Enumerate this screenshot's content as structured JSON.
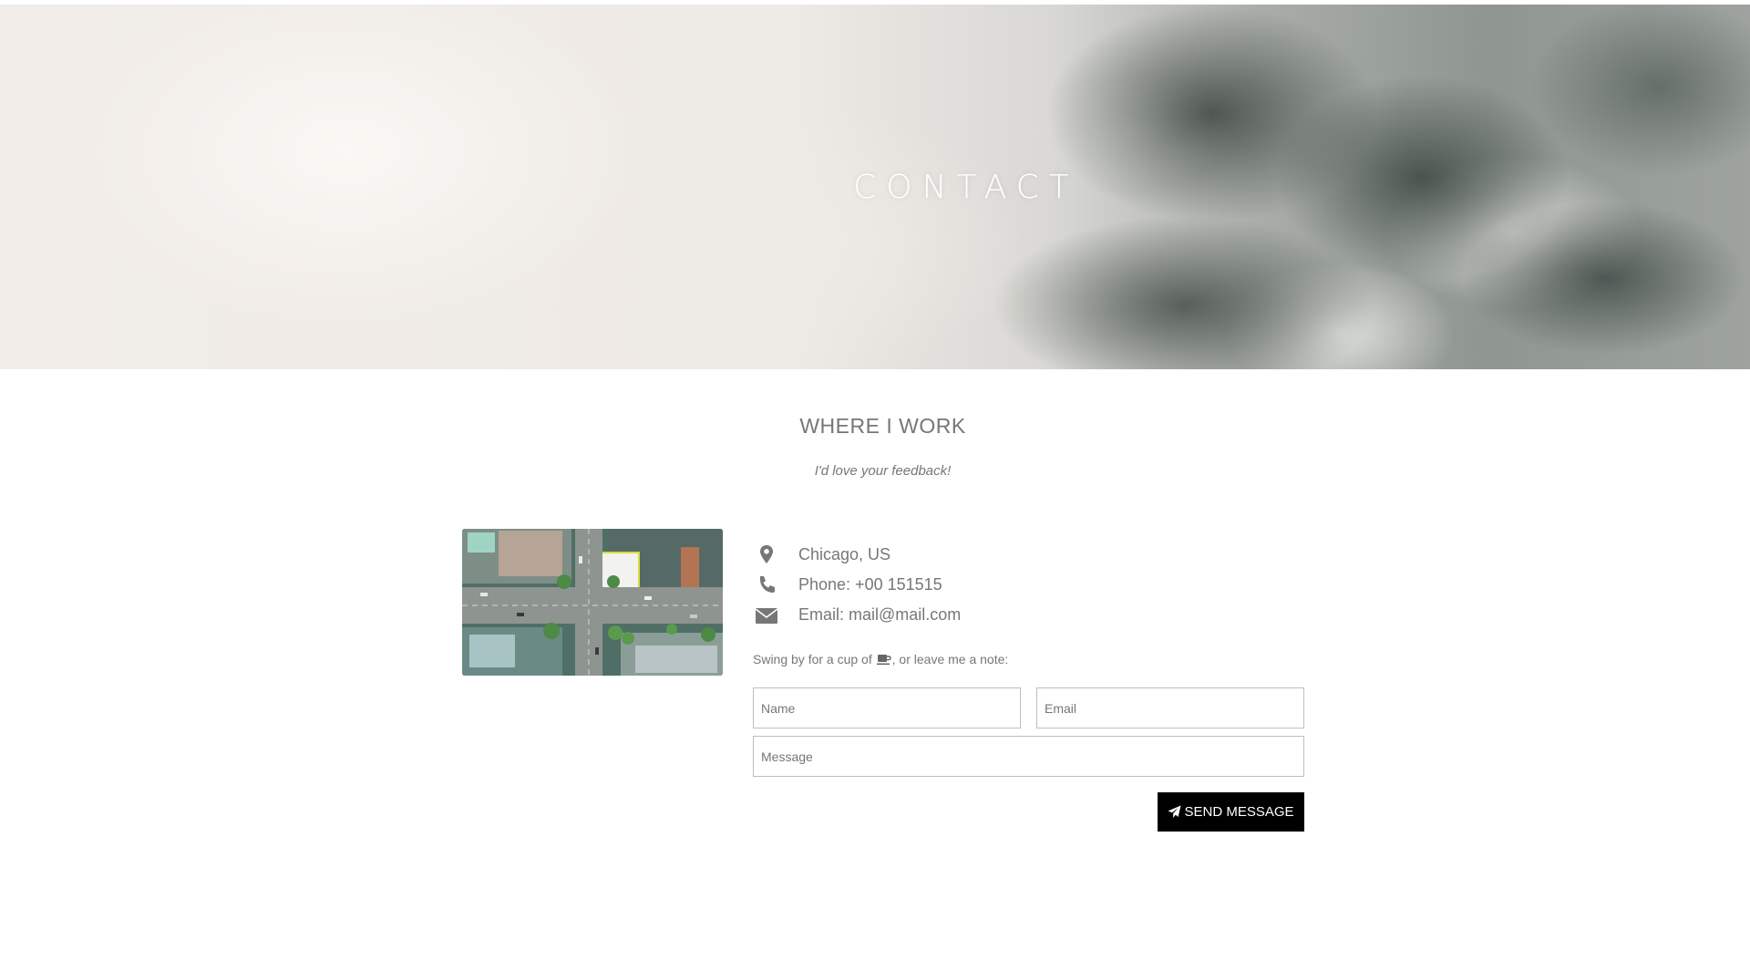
{
  "hero": {
    "title": "CONTACT"
  },
  "section": {
    "title": "WHERE I WORK",
    "subtitle": "I'd love your feedback!"
  },
  "contact_info": [
    {
      "icon": "map-marker-icon",
      "text": "Chicago, US"
    },
    {
      "icon": "phone-icon",
      "text": "Phone: +00 151515"
    },
    {
      "icon": "envelope-icon",
      "text": "Email: mail@mail.com"
    }
  ],
  "note": {
    "before": "Swing by for a cup of ",
    "icon": "coffee-icon",
    "after": ", or leave me a note:"
  },
  "form": {
    "name_placeholder": "Name",
    "email_placeholder": "Email",
    "message_placeholder": "Message",
    "send_label": "SEND MESSAGE",
    "send_icon": "paper-plane-icon"
  },
  "colors": {
    "text": "#777777",
    "button_bg": "#000000",
    "button_text": "#ffffff",
    "field_border": "#bfbfbf"
  }
}
